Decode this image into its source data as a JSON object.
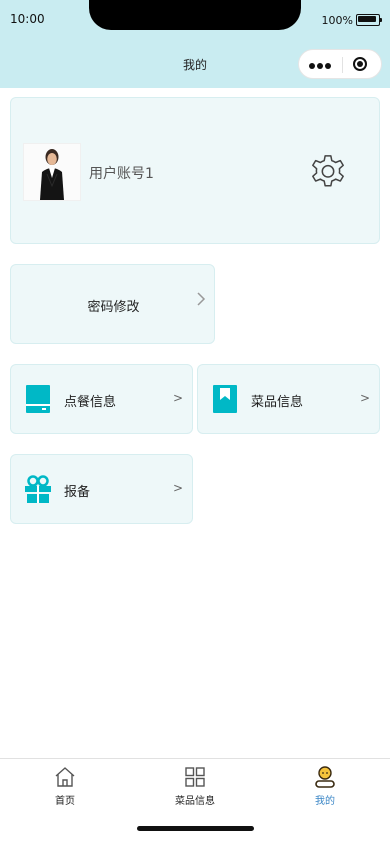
{
  "status_bar": {
    "time": "10:00",
    "battery": "100%"
  },
  "nav": {
    "title": "我的"
  },
  "profile": {
    "username": "用户账号1"
  },
  "password_card": {
    "label": "密码修改",
    "arrow": ">"
  },
  "tiles": [
    {
      "label": "点餐信息",
      "arrow": ">"
    },
    {
      "label": "菜品信息",
      "arrow": ">"
    },
    {
      "label": "报备",
      "arrow": ">"
    }
  ],
  "tabbar": {
    "items": [
      {
        "label": "首页"
      },
      {
        "label": "菜品信息"
      },
      {
        "label": "我的"
      }
    ]
  },
  "colors": {
    "accent": "#00b8c6",
    "header": "#c9ecf1",
    "card": "#eef8f9",
    "active_tab": "#3a86c6"
  }
}
